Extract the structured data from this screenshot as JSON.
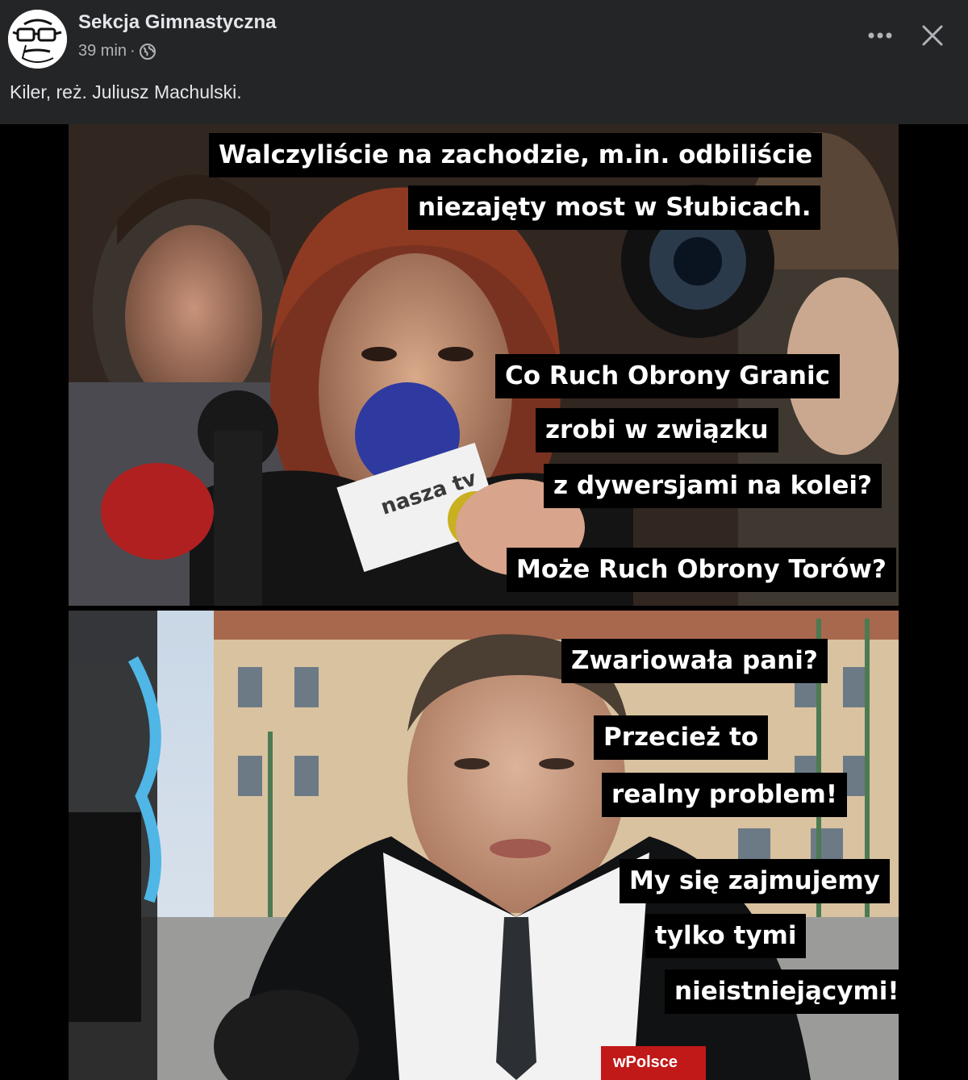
{
  "post": {
    "author_name": "Sekcja Gimnastyczna",
    "timestamp": "39 min",
    "separator": "·",
    "audience_icon": "globe-icon",
    "more_icon": "more-options-icon",
    "close_icon": "close-icon",
    "text": "Kiler, reż. Juliusz Machulski."
  },
  "meme": {
    "top_panel": {
      "captions": [
        "Walczyliście na zachodzie, m.in. odbiliście",
        "niezajęty most w Słubicach.",
        "Co Ruch Obrony Granic",
        "zrobi w związku",
        "z dywersjami na kolei?",
        "Może Ruch Obrony Torów?"
      ],
      "mic_logo": "nasza tv"
    },
    "bottom_panel": {
      "captions": [
        "Zwariowała pani?",
        "Przecież to",
        "realny problem!",
        "My się zajmujemy",
        "tylko tymi",
        "nieistniejącymi!"
      ],
      "mic_logo": "wPolsce"
    }
  },
  "colors": {
    "background": "#242526",
    "text_primary": "#e4e6eb",
    "text_secondary": "#b0b3b8",
    "caption_bg": "#000000",
    "caption_text": "#ffffff"
  }
}
